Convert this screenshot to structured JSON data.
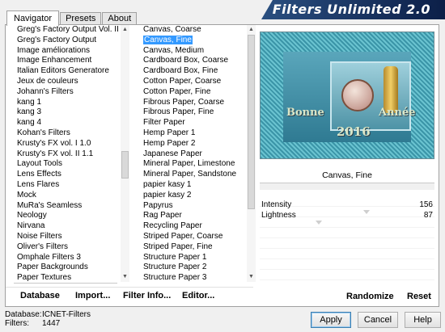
{
  "tabs": [
    "Navigator",
    "Presets",
    "About"
  ],
  "banner_title": "Filters Unlimited 2.0",
  "categories": [
    "Greg's Factory Output Vol. II",
    "Greg's Factory Output",
    "Image améliorations",
    "Image Enhancement",
    "Italian Editors Generatore",
    "Jeux de couleurs",
    "Johann's Filters",
    "kang 1",
    "kang 3",
    "kang 4",
    "Kohan's Filters",
    "Krusty's FX vol. I 1.0",
    "Krusty's FX vol. II 1.1",
    "Layout Tools",
    "Lens Effects",
    "Lens Flares",
    "Mock",
    "MuRa's Seamless",
    "Neology",
    "Nirvana",
    "Noise Filters",
    "Oliver's Filters",
    "Omphale Filters 3",
    "Paper Backgrounds",
    "Paper Textures"
  ],
  "selected_category": "Paper Textures",
  "filters": [
    "Canvas, Coarse",
    "Canvas, Fine",
    "Canvas, Medium",
    "Cardboard Box, Coarse",
    "Cardboard Box, Fine",
    "Cotton Paper, Coarse",
    "Cotton Paper, Fine",
    "Fibrous Paper, Coarse",
    "Fibrous Paper, Fine",
    "Filter Paper",
    "Hemp Paper 1",
    "Hemp Paper 2",
    "Japanese Paper",
    "Mineral Paper, Limestone",
    "Mineral Paper, Sandstone",
    "papier kasy 1",
    "papier kasy 2",
    "Papyrus",
    "Rag Paper",
    "Recycling Paper",
    "Striped Paper, Coarse",
    "Striped Paper, Fine",
    "Structure Paper 1",
    "Structure Paper 2",
    "Structure Paper 3"
  ],
  "selected_filter": "Canvas, Fine",
  "list_buttons": {
    "database": "Database",
    "import": "Import...",
    "filter_info": "Filter Info...",
    "editor": "Editor..."
  },
  "preview": {
    "text_left": "Bonne",
    "text_right": "Année",
    "year": "2016"
  },
  "current_filter_name": "Canvas, Fine",
  "parameters": [
    {
      "label": "Intensity",
      "value": "156"
    },
    {
      "label": "Lightness",
      "value": "87"
    }
  ],
  "parameter_levels": [
    0.61,
    0.34
  ],
  "right_buttons": {
    "randomize": "Randomize",
    "reset": "Reset"
  },
  "status": {
    "database_label": "Database:",
    "database_value": "ICNET-Filters",
    "filters_label": "Filters:",
    "filters_value": "1447"
  },
  "dialog_buttons": {
    "apply": "Apply",
    "cancel": "Cancel",
    "help": "Help"
  },
  "colors": {
    "selection": "#3399ff",
    "banner": "#0c1f48"
  }
}
